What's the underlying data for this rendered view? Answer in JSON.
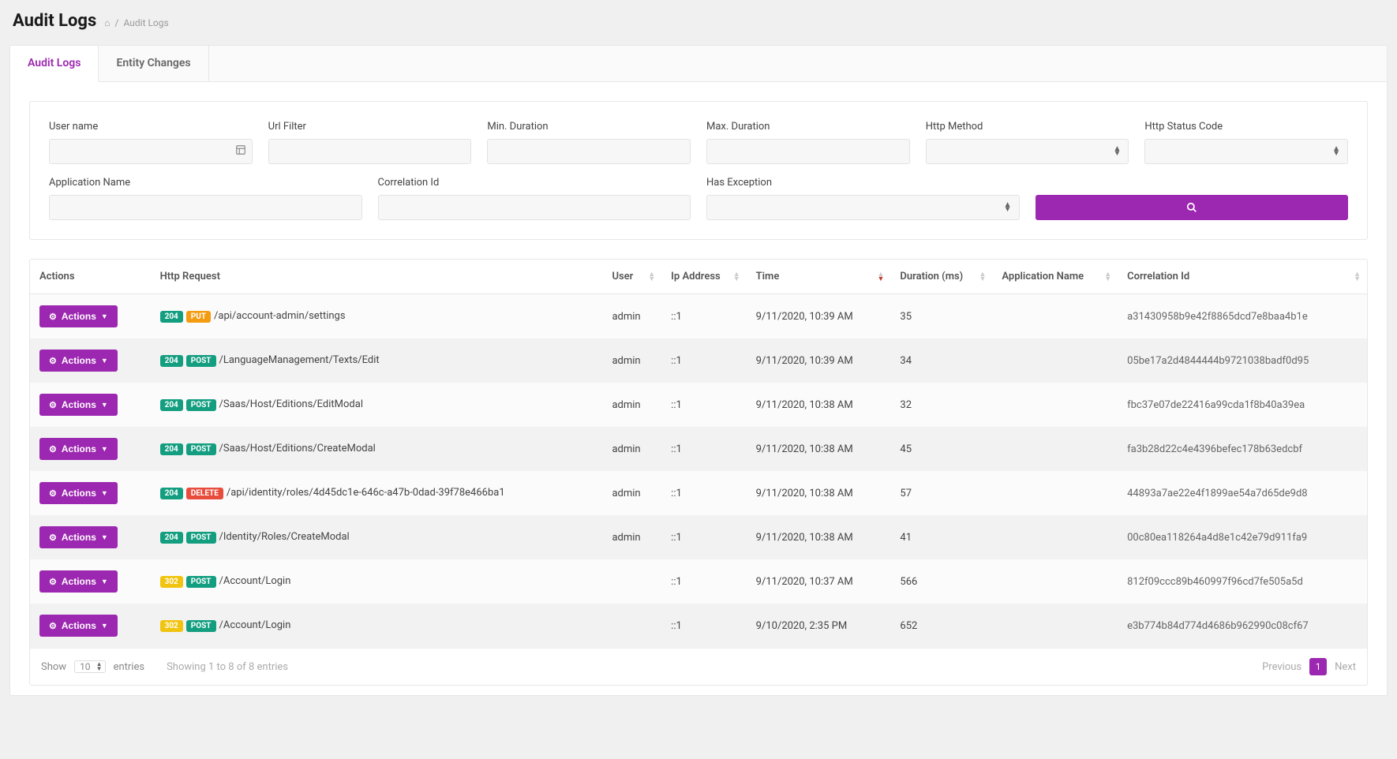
{
  "header": {
    "title": "Audit Logs",
    "breadcrumb_home_icon": "home",
    "breadcrumb_sep": "/",
    "breadcrumb_current": "Audit Logs"
  },
  "tabs": {
    "audit": "Audit Logs",
    "entity": "Entity Changes"
  },
  "filters": {
    "username_label": "User name",
    "username_value": "",
    "url_label": "Url Filter",
    "url_value": "",
    "min_dur_label": "Min. Duration",
    "min_dur_value": "",
    "max_dur_label": "Max. Duration",
    "max_dur_value": "",
    "http_method_label": "Http Method",
    "http_method_value": "",
    "http_status_label": "Http Status Code",
    "http_status_value": "",
    "app_name_label": "Application Name",
    "app_name_value": "",
    "correlation_label": "Correlation Id",
    "correlation_value": "",
    "has_exception_label": "Has Exception",
    "has_exception_value": ""
  },
  "columns": {
    "actions": "Actions",
    "http": "Http Request",
    "user": "User",
    "ip": "Ip Address",
    "time": "Time",
    "duration": "Duration (ms)",
    "app": "Application Name",
    "corr": "Correlation Id"
  },
  "action_button_label": "Actions",
  "rows": [
    {
      "status": "204",
      "method": "PUT",
      "url": "/api/account-admin/settings",
      "user": "admin",
      "ip": "::1",
      "time": "9/11/2020, 10:39 AM",
      "duration": "35",
      "app": "",
      "corr": "a31430958b9e42f8865dcd7e8baa4b1e"
    },
    {
      "status": "204",
      "method": "POST",
      "url": "/LanguageManagement/Texts/Edit",
      "user": "admin",
      "ip": "::1",
      "time": "9/11/2020, 10:39 AM",
      "duration": "34",
      "app": "",
      "corr": "05be17a2d4844444b9721038badf0d95"
    },
    {
      "status": "204",
      "method": "POST",
      "url": "/Saas/Host/Editions/EditModal",
      "user": "admin",
      "ip": "::1",
      "time": "9/11/2020, 10:38 AM",
      "duration": "32",
      "app": "",
      "corr": "fbc37e07de22416a99cda1f8b40a39ea"
    },
    {
      "status": "204",
      "method": "POST",
      "url": "/Saas/Host/Editions/CreateModal",
      "user": "admin",
      "ip": "::1",
      "time": "9/11/2020, 10:38 AM",
      "duration": "45",
      "app": "",
      "corr": "fa3b28d22c4e4396befec178b63edcbf"
    },
    {
      "status": "204",
      "method": "DELETE",
      "url": "/api/identity/roles/4d45dc1e-646c-a47b-0dad-39f78e466ba1",
      "user": "admin",
      "ip": "::1",
      "time": "9/11/2020, 10:38 AM",
      "duration": "57",
      "app": "",
      "corr": "44893a7ae22e4f1899ae54a7d65de9d8"
    },
    {
      "status": "204",
      "method": "POST",
      "url": "/Identity/Roles/CreateModal",
      "user": "admin",
      "ip": "::1",
      "time": "9/11/2020, 10:38 AM",
      "duration": "41",
      "app": "",
      "corr": "00c80ea118264a4d8e1c42e79d911fa9"
    },
    {
      "status": "302",
      "method": "POST",
      "url": "/Account/Login",
      "user": "",
      "ip": "::1",
      "time": "9/11/2020, 10:37 AM",
      "duration": "566",
      "app": "",
      "corr": "812f09ccc89b460997f96cd7fe505a5d"
    },
    {
      "status": "302",
      "method": "POST",
      "url": "/Account/Login",
      "user": "",
      "ip": "::1",
      "time": "9/10/2020, 2:35 PM",
      "duration": "652",
      "app": "",
      "corr": "e3b774b84d774d4686b962990c08cf67"
    }
  ],
  "footer": {
    "show_label": "Show",
    "page_size": "10",
    "entries_label": "entries",
    "info": "Showing 1 to 8 of 8 entries",
    "prev": "Previous",
    "page": "1",
    "next": "Next"
  }
}
